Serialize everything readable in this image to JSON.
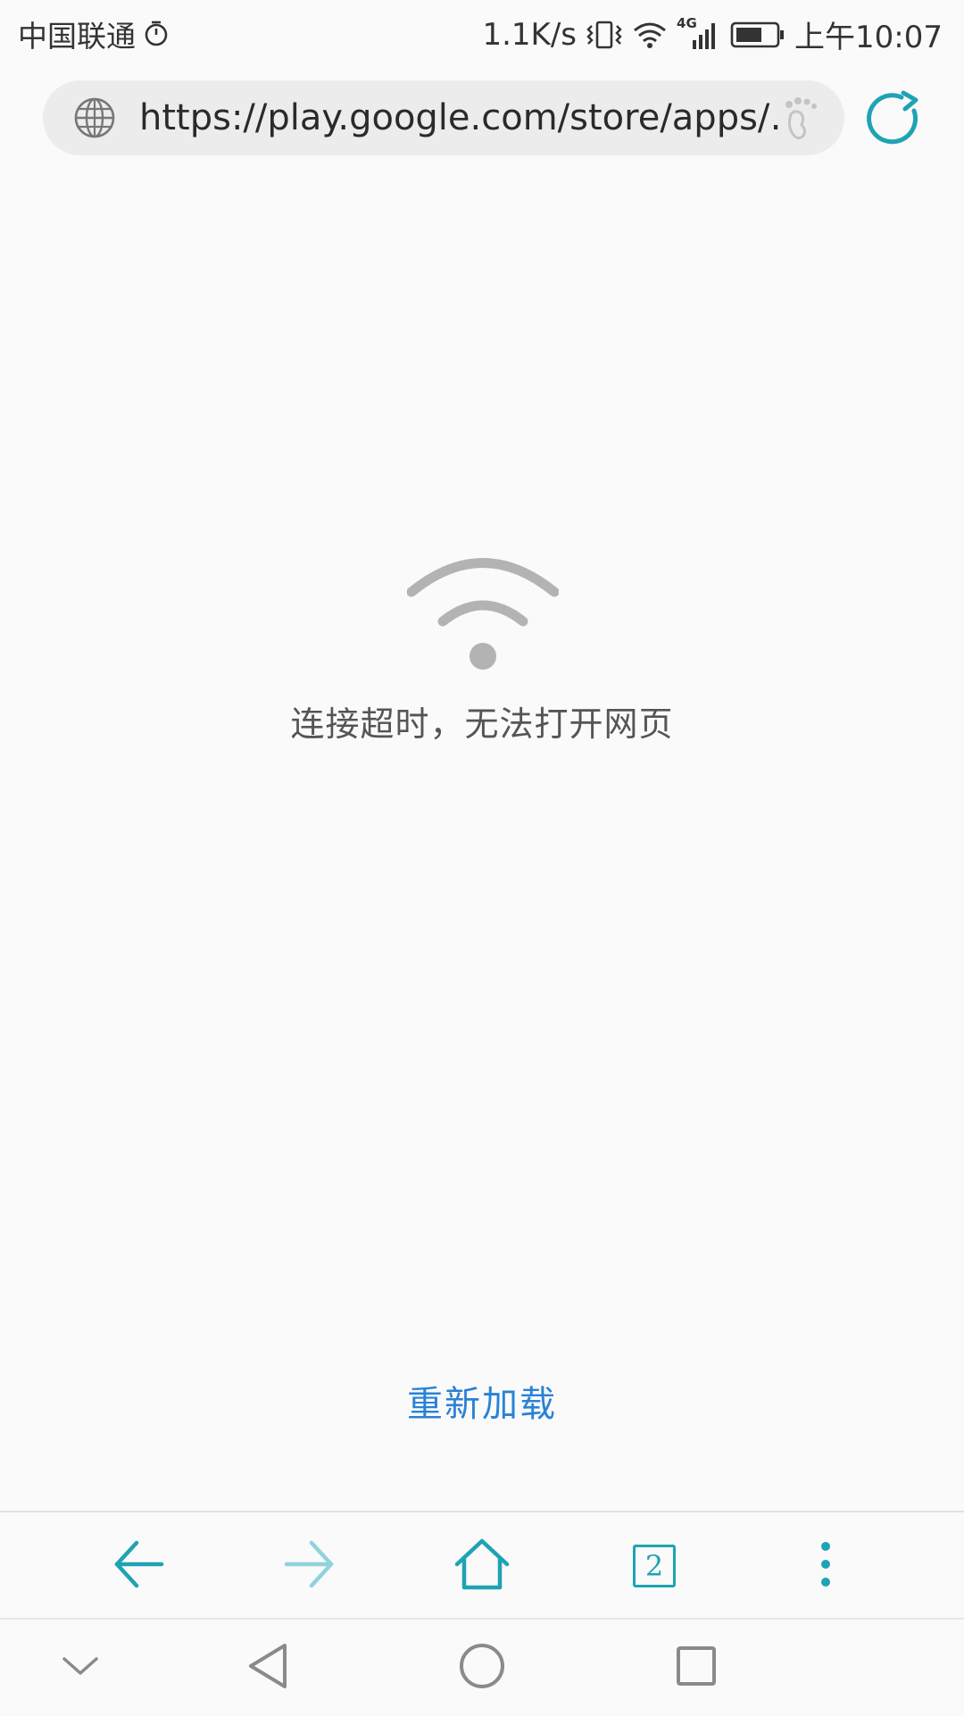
{
  "status_bar": {
    "carrier": "中国联通",
    "net_speed": "1.1K/s",
    "network_type": "4G",
    "time": "上午10:07",
    "icons": [
      "alarm-clock-icon",
      "vibrate-icon",
      "wifi-icon",
      "cell-signal-icon",
      "battery-icon"
    ]
  },
  "address_bar": {
    "url": "https://play.google.com/store/apps/…",
    "site_icon": "globe-icon",
    "extra_icon": "footprint-icon",
    "action_icon": "refresh-icon"
  },
  "error_page": {
    "icon": "wifi-icon",
    "message": "连接超时，无法打开网页",
    "reload_label": "重新加载"
  },
  "toolbar": {
    "tab_count": "2",
    "buttons": [
      "back-icon",
      "forward-icon",
      "home-icon",
      "tabs-icon",
      "more-icon"
    ]
  },
  "nav_bar": {
    "buttons": [
      "hide-nav-icon",
      "back-triangle-icon",
      "home-circle-icon",
      "recents-square-icon"
    ]
  },
  "colors": {
    "accent": "#1ea3b4",
    "link": "#2a82d6",
    "icon_gray": "#b3b3b3",
    "background": "#fafafa"
  }
}
